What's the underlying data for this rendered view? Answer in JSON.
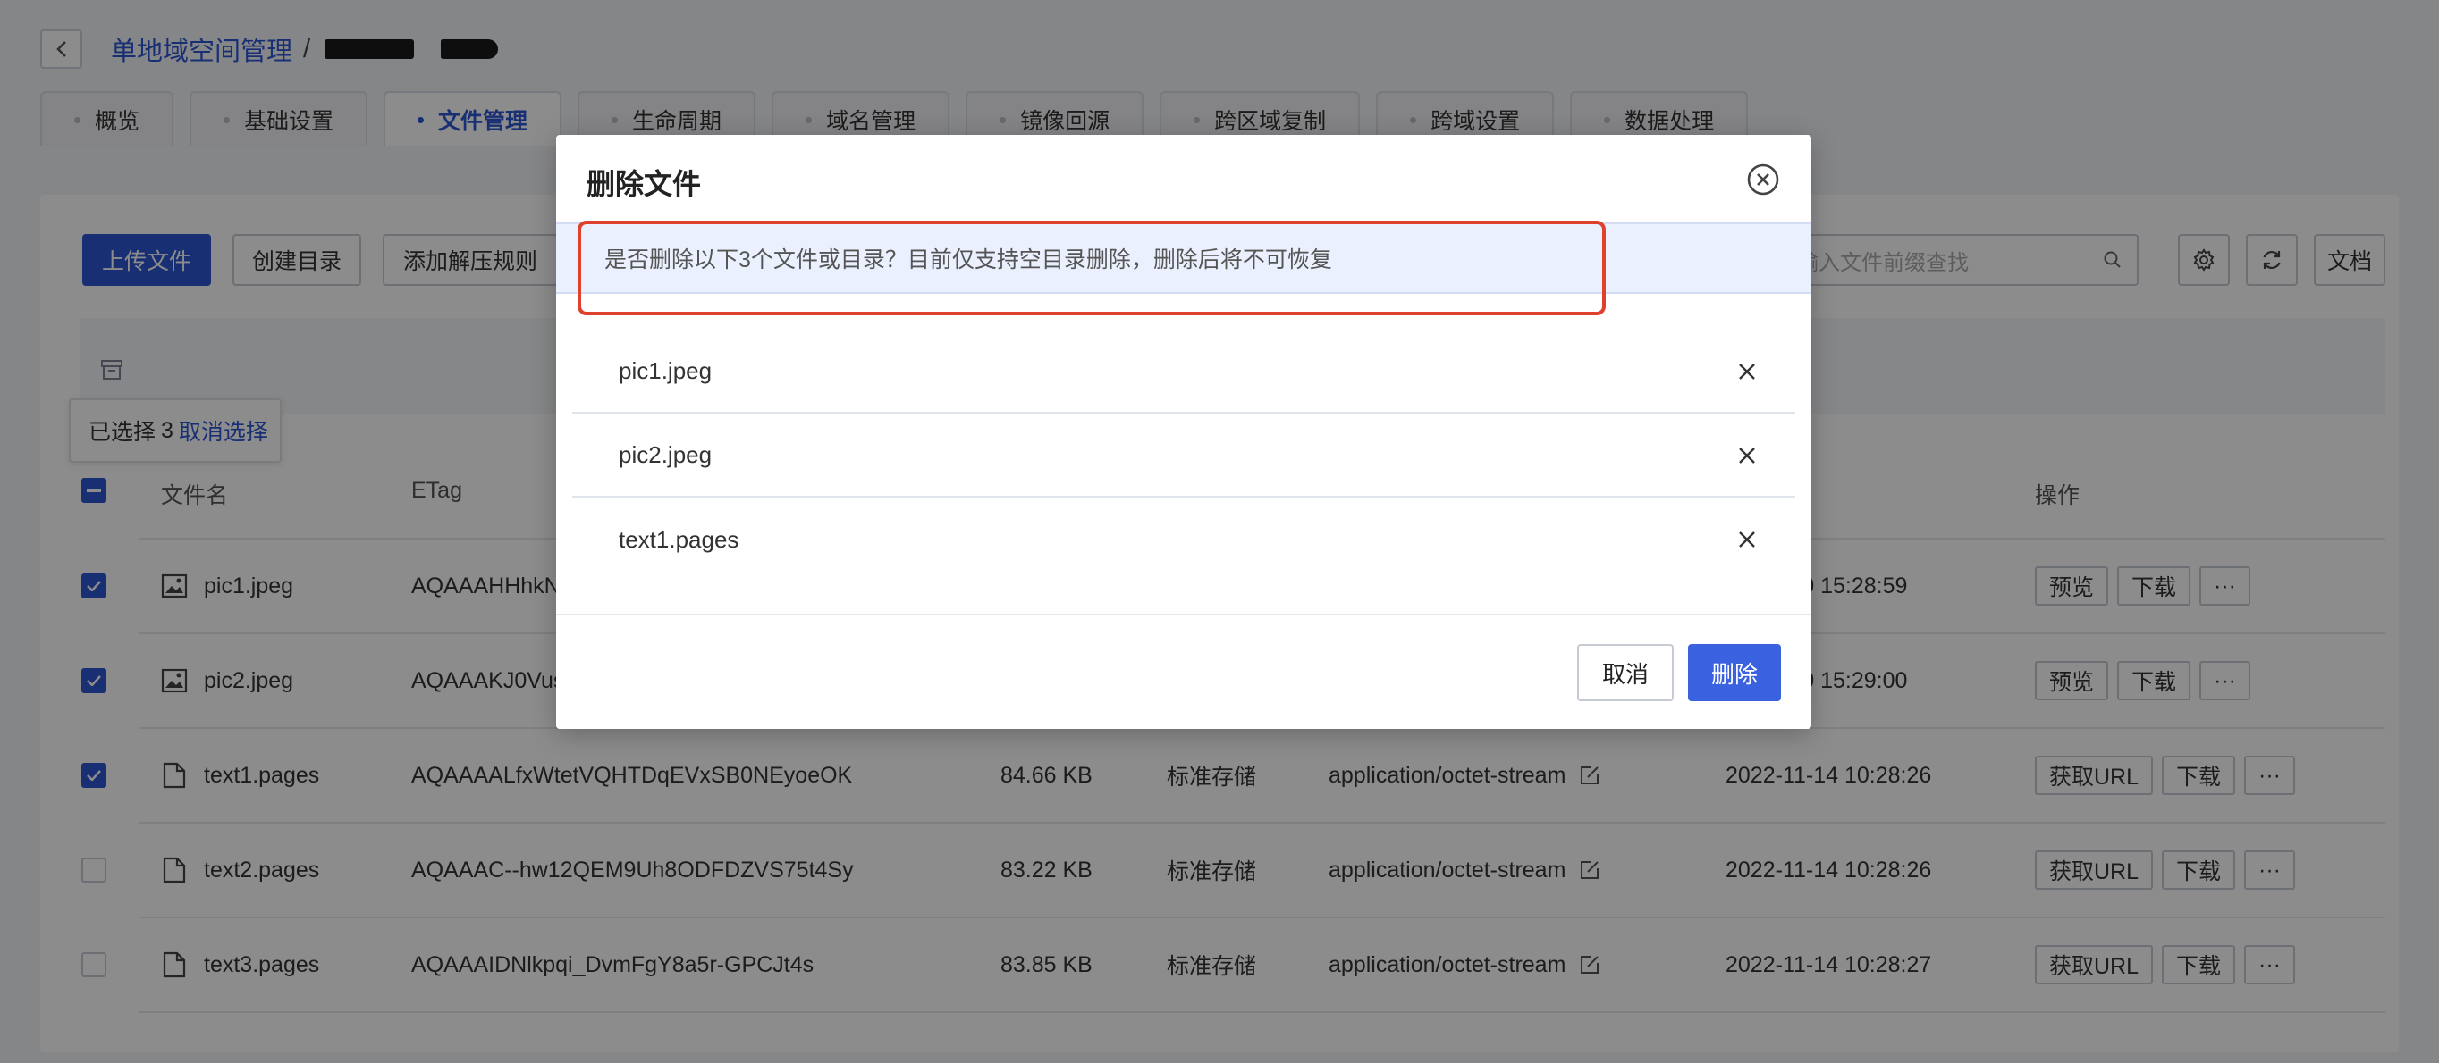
{
  "header": {
    "back_icon": "chevron-left-icon",
    "breadcrumb_root": "单地域空间管理",
    "breadcrumb_sep": "/"
  },
  "tabs": [
    {
      "label": "概览"
    },
    {
      "label": "基础设置"
    },
    {
      "label": "文件管理",
      "active": true
    },
    {
      "label": "生命周期"
    },
    {
      "label": "域名管理"
    },
    {
      "label": "镜像回源"
    },
    {
      "label": "跨区域复制"
    },
    {
      "label": "跨域设置"
    },
    {
      "label": "数据处理"
    }
  ],
  "toolbar": {
    "upload": "上传文件",
    "mkdir": "创建目录",
    "unzip_rule": "添加解压规则",
    "search_placeholder": "输入文件前缀查找",
    "docs": "文档"
  },
  "selection": {
    "prefix": "已选择",
    "count": "3",
    "cancel": "取消选择"
  },
  "table": {
    "headers": {
      "name": "文件名",
      "etag": "ETag",
      "ops": "操作"
    },
    "rows": [
      {
        "checked": true,
        "icon": "image-icon",
        "name": "pic1.jpeg",
        "etag": "AQAAAHHhkN",
        "size": "",
        "storage": "",
        "mime": "",
        "time": "-10 15:28:59",
        "ops": [
          "预览",
          "下载",
          "···"
        ]
      },
      {
        "checked": true,
        "icon": "image-icon",
        "name": "pic2.jpeg",
        "etag": "AQAAAKJ0Vus",
        "size": "",
        "storage": "",
        "mime": "",
        "time": "-10 15:29:00",
        "ops": [
          "预览",
          "下载",
          "···"
        ]
      },
      {
        "checked": true,
        "icon": "file-icon",
        "name": "text1.pages",
        "etag": "AQAAAALfxWtetVQHTDqEVxSB0NEyoeOK",
        "size": "84.66 KB",
        "storage": "标准存储",
        "mime": "application/octet-stream",
        "time": "2022-11-14 10:28:26",
        "ops": [
          "获取URL",
          "下载",
          "···"
        ]
      },
      {
        "checked": false,
        "icon": "file-icon",
        "name": "text2.pages",
        "etag": "AQAAAC--hw12QEM9Uh8ODFDZVS75t4Sy",
        "size": "83.22 KB",
        "storage": "标准存储",
        "mime": "application/octet-stream",
        "time": "2022-11-14 10:28:26",
        "ops": [
          "获取URL",
          "下载",
          "···"
        ]
      },
      {
        "checked": false,
        "icon": "file-icon",
        "name": "text3.pages",
        "etag": "AQAAAIDNlkpqi_DvmFgY8a5r-GPCJt4s",
        "size": "83.85 KB",
        "storage": "标准存储",
        "mime": "application/octet-stream",
        "time": "2022-11-14 10:28:27",
        "ops": [
          "获取URL",
          "下载",
          "···"
        ]
      }
    ]
  },
  "modal": {
    "title": "删除文件",
    "alert": "是否删除以下3个文件或目录？目前仅支持空目录删除，删除后将不可恢复",
    "files": [
      "pic1.jpeg",
      "pic2.jpeg",
      "text1.pages"
    ],
    "cancel": "取消",
    "confirm": "删除",
    "highlight_color": "#e0412d"
  },
  "colors": {
    "accent": "#2f56d3",
    "danger_highlight": "#e0412d"
  }
}
